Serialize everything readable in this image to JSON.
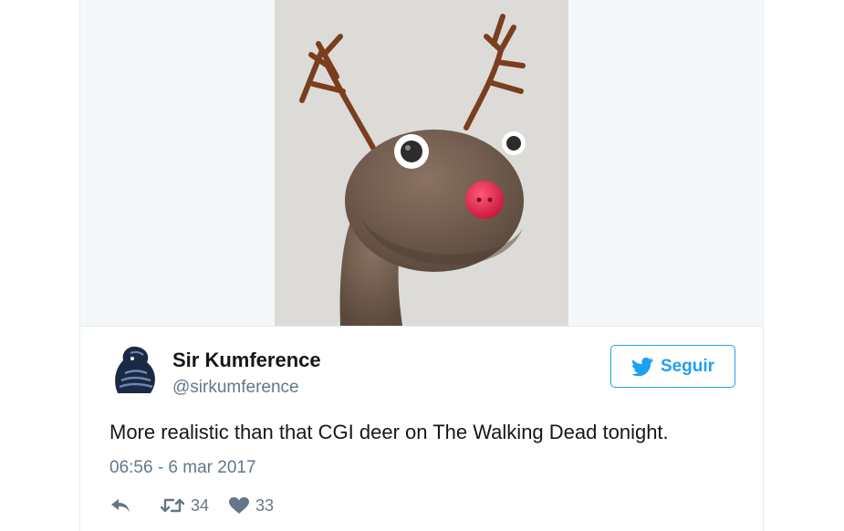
{
  "tweet": {
    "author_name": "Sir Kumference",
    "author_handle": "@sirkumference",
    "follow_label": "Seguir",
    "text": "More realistic than that CGI deer on The Walking Dead tonight.",
    "timestamp": "06:56 - 6 mar 2017",
    "retweet_count": "34",
    "like_count": "33"
  },
  "icons": {
    "reply": "reply-icon",
    "retweet": "retweet-icon",
    "like": "heart-icon",
    "follow": "twitter-bird-icon"
  },
  "colors": {
    "accent": "#1da1f2",
    "text": "#14171a",
    "muted": "#657786"
  }
}
